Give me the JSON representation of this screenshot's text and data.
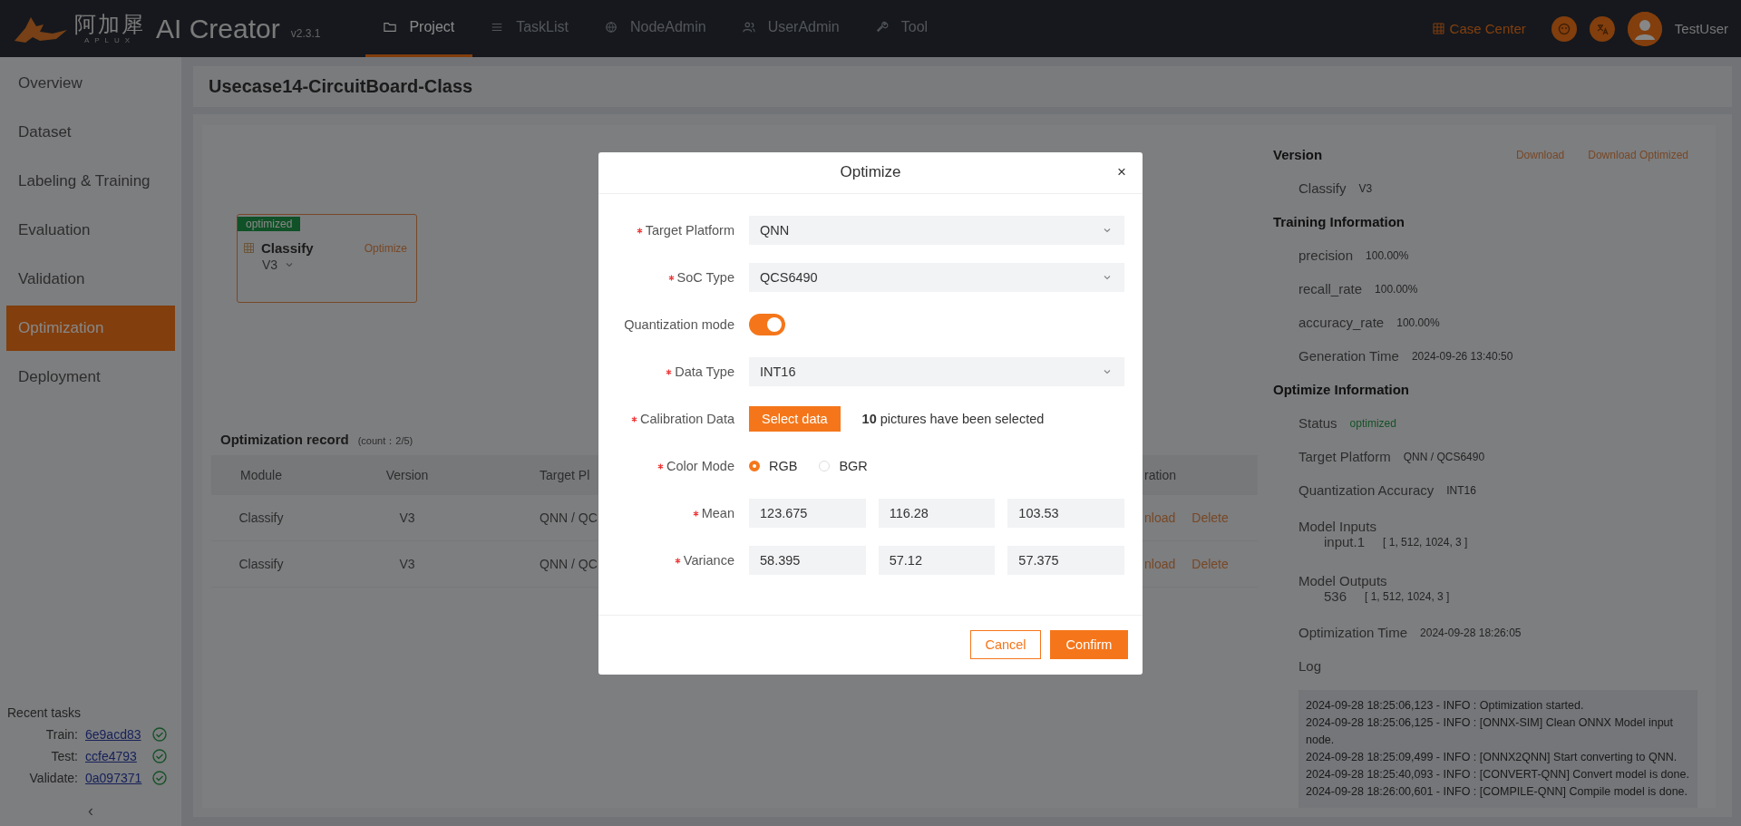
{
  "header": {
    "logo_cn": "阿加犀",
    "logo_en": "APLUX",
    "app_name": "AI Creator",
    "version": "v2.3.1",
    "nav": [
      {
        "label": "Project",
        "selected": true
      },
      {
        "label": "TaskList",
        "selected": false
      },
      {
        "label": "NodeAdmin",
        "selected": false
      },
      {
        "label": "UserAdmin",
        "selected": false
      },
      {
        "label": "Tool",
        "selected": false
      }
    ],
    "case_center": "Case Center",
    "user": "TestUser"
  },
  "sidebar": {
    "items": [
      {
        "label": "Overview",
        "selected": false
      },
      {
        "label": "Dataset",
        "selected": false
      },
      {
        "label": "Labeling & Training",
        "selected": false
      },
      {
        "label": "Evaluation",
        "selected": false
      },
      {
        "label": "Validation",
        "selected": false
      },
      {
        "label": "Optimization",
        "selected": true
      },
      {
        "label": "Deployment",
        "selected": false
      }
    ],
    "recent_tasks": {
      "title": "Recent tasks",
      "tasks": [
        {
          "label": "Train:",
          "id": "6e9acd83",
          "done": true
        },
        {
          "label": "Test:",
          "id": "ccfe4793",
          "done": true
        },
        {
          "label": "Validate:",
          "id": "0a097371",
          "done": true
        }
      ]
    },
    "collapse": "‹"
  },
  "page_title": "Usecase14-CircuitBoard-Class",
  "canvas": {
    "node": {
      "badge": "optimized",
      "name": "Classify",
      "version": "V3",
      "action": "Optimize"
    }
  },
  "optimization_record": {
    "title": "Optimization record",
    "count": "(count：2/5)",
    "columns": [
      "Module",
      "Version",
      "Target Pl",
      "ration"
    ],
    "rows": [
      {
        "cells": [
          "Classify",
          "V3",
          "QNN / QC"
        ],
        "actions": [
          "nload",
          "Delete"
        ]
      },
      {
        "cells": [
          "Classify",
          "V3",
          "QNN / QC"
        ],
        "actions": [
          "nload",
          "Delete"
        ]
      }
    ]
  },
  "details": {
    "version": {
      "title": "Version",
      "actions": [
        "Download",
        "Download Optimized"
      ],
      "module": "Classify",
      "version": "V3"
    },
    "training": {
      "title": "Training Information",
      "rows": [
        {
          "kind": "pair",
          "label": "precision",
          "value": "100.00%"
        },
        {
          "kind": "pair",
          "label": "recall_rate",
          "value": "100.00%"
        },
        {
          "kind": "pair",
          "label": "accuracy_rate",
          "value": "100.00%"
        },
        {
          "kind": "pair",
          "label": "Generation Time",
          "value": "2024-09-26 13:40:50"
        }
      ]
    },
    "optimize": {
      "title": "Optimize Information",
      "rows": [
        {
          "kind": "status",
          "label": "Status",
          "value": "optimized"
        },
        {
          "kind": "pair",
          "label": "Target Platform",
          "value": "QNN / QCS6490"
        },
        {
          "kind": "pair",
          "label": "Quantization Accuracy",
          "value": "INT16"
        },
        {
          "kind": "io",
          "label": "Model Inputs",
          "name": "input.1",
          "value": "[ 1, 512, 1024, 3 ]"
        },
        {
          "kind": "io",
          "label": "Model Outputs",
          "name": "536",
          "value": "[ 1, 512, 1024, 3 ]"
        },
        {
          "kind": "pair",
          "label": "Optimization Time",
          "value": "2024-09-28 18:26:05"
        }
      ]
    },
    "log": {
      "label": "Log",
      "lines": [
        "2024-09-28 18:25:06,123 - INFO : Optimization started.",
        "2024-09-28 18:25:06,125 - INFO : [ONNX-SIM] Clean ONNX Model input node.",
        "2024-09-28 18:25:09,499 - INFO : [ONNX2QNN] Start converting to QNN.",
        "2024-09-28 18:25:40,093 - INFO : [CONVERT-QNN] Convert model is done.",
        "2024-09-28 18:26:00,601 - INFO : [COMPILE-QNN] Compile model is done."
      ]
    }
  },
  "modal": {
    "title": "Optimize",
    "close": "×",
    "fields": [
      {
        "kind": "select",
        "label": "Target Platform",
        "required": true,
        "value": "QNN"
      },
      {
        "kind": "select",
        "label": "SoC Type",
        "required": true,
        "value": "QCS6490"
      },
      {
        "kind": "switch",
        "label": "Quantization mode",
        "required": false,
        "on": true
      },
      {
        "kind": "select",
        "label": "Data Type",
        "required": true,
        "value": "INT16"
      },
      {
        "kind": "upload",
        "label": "Calibration Data",
        "required": true,
        "button": "Select data",
        "note": "**10** pictures have been selected"
      },
      {
        "kind": "radio",
        "label": "Color Mode",
        "required": true,
        "options": [
          {
            "label": "RGB",
            "selected": true
          },
          {
            "label": "BGR",
            "selected": false
          }
        ]
      },
      {
        "kind": "triple",
        "label": "Mean",
        "required": true,
        "values": [
          "123.675",
          "116.28",
          "103.53"
        ]
      },
      {
        "kind": "triple",
        "label": "Variance",
        "required": true,
        "values": [
          "58.395",
          "57.12",
          "57.375"
        ]
      }
    ],
    "buttons": [
      {
        "label": "Cancel",
        "kind": "secondary"
      },
      {
        "label": "Confirm",
        "kind": "primary"
      }
    ]
  }
}
